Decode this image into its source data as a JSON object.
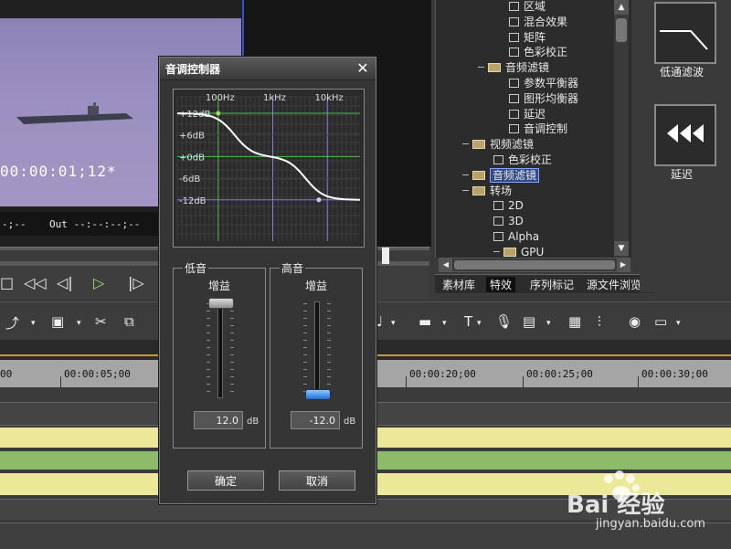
{
  "preview": {
    "timecode": "00:00:01;12*",
    "in_label": "-;--",
    "out_label": "Out --:--:--;--"
  },
  "tree": {
    "items": [
      {
        "label": "区域",
        "indent": 4,
        "kind": "effect"
      },
      {
        "label": "混合效果",
        "indent": 4,
        "kind": "effect"
      },
      {
        "label": "矩阵",
        "indent": 4,
        "kind": "effect"
      },
      {
        "label": "色彩校正",
        "indent": 4,
        "kind": "effect"
      },
      {
        "label": "音频滤镜",
        "indent": 2,
        "kind": "folder"
      },
      {
        "label": "参数平衡器",
        "indent": 4,
        "kind": "effect"
      },
      {
        "label": "图形均衡器",
        "indent": 4,
        "kind": "effect"
      },
      {
        "label": "延迟",
        "indent": 4,
        "kind": "effect"
      },
      {
        "label": "音调控制",
        "indent": 4,
        "kind": "effect"
      },
      {
        "label": "视频滤镜",
        "indent": 1,
        "kind": "folder"
      },
      {
        "label": "色彩校正",
        "indent": 3,
        "kind": "effect"
      },
      {
        "label": "音频滤镜",
        "indent": 1,
        "kind": "folder",
        "selected": true
      },
      {
        "label": "转场",
        "indent": 1,
        "kind": "folder"
      },
      {
        "label": "2D",
        "indent": 3,
        "kind": "effect"
      },
      {
        "label": "3D",
        "indent": 3,
        "kind": "effect"
      },
      {
        "label": "Alpha",
        "indent": 3,
        "kind": "effect"
      },
      {
        "label": "GPU",
        "indent": 3,
        "kind": "folder"
      }
    ]
  },
  "tabs": [
    "素材库",
    "特效",
    "序列标记",
    "源文件浏览"
  ],
  "fx": {
    "lowpass_label": "低通滤波",
    "delay_label": "延迟"
  },
  "ruler": [
    "00",
    "00:00:05;00",
    "00:00:20;00",
    "00:00:25;00",
    "00:00:30;00"
  ],
  "dialog": {
    "title": "音调控制器",
    "freq_labels": [
      "100Hz",
      "1kHz",
      "10kHz"
    ],
    "db_labels": [
      "+12dB",
      "+6dB",
      "+0dB",
      "-6dB",
      "-12dB"
    ],
    "bass": {
      "title": "低音",
      "gain_label": "增益",
      "value": "12.0",
      "unit": "dB",
      "gain_db": 12
    },
    "treble": {
      "title": "高音",
      "gain_label": "增益",
      "value": "-12.0",
      "unit": "dB",
      "gain_db": -12
    },
    "ok": "确定",
    "cancel": "取消"
  },
  "watermark": {
    "brand": "Bai 经验",
    "url": "jingyan.baidu.com"
  }
}
